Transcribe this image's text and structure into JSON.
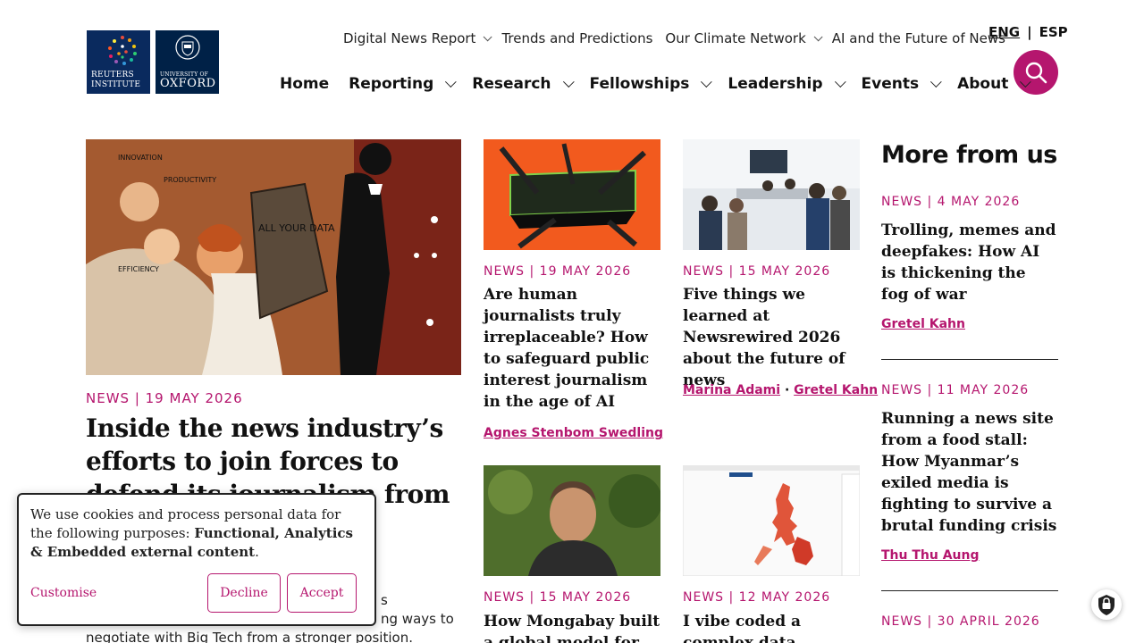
{
  "logos": {
    "reuters": {
      "line1": "REUTERS",
      "line2": "INSTITUTE"
    },
    "oxford": {
      "line1": "UNIVERSITY OF",
      "line2": "OXFORD"
    }
  },
  "topnav": [
    {
      "label": "Digital News Report",
      "dropdown": true
    },
    {
      "label": "Trends and Predictions",
      "dropdown": false
    },
    {
      "label": "Our Climate Network",
      "dropdown": true
    },
    {
      "label": "AI and the Future of News",
      "dropdown": false
    }
  ],
  "lang": {
    "eng": "ENG",
    "sep": "|",
    "esp": "ESP"
  },
  "mainnav": [
    {
      "label": "Home",
      "dropdown": false
    },
    {
      "label": "Reporting",
      "dropdown": true
    },
    {
      "label": "Research",
      "dropdown": true
    },
    {
      "label": "Fellowships",
      "dropdown": true
    },
    {
      "label": "Leadership",
      "dropdown": true
    },
    {
      "label": "Events",
      "dropdown": true
    },
    {
      "label": "About",
      "dropdown": true
    }
  ],
  "hero": {
    "image_text": {
      "innovation": "INNOVATION",
      "productivity": "PRODUCTIVITY",
      "efficiency": "EFFICIENCY",
      "board": "ALL YOUR DATA"
    },
    "meta": "NEWS | 19 MAY 2026",
    "title": "Inside the news industry’s efforts to join forces to defend its journalism from",
    "body_right": "s",
    "body_line2": "ng ways to",
    "body_line3": "negotiate with Big Tech from a stronger position."
  },
  "cards": [
    {
      "meta": "NEWS | 19 MAY 2026",
      "title": "Are human journalists truly irreplaceable? How to safeguard public interest journalism in the age of AI",
      "authors": [
        "Agnes Stenbom Swedling"
      ]
    },
    {
      "meta": "NEWS | 15 MAY 2026",
      "title": "Five things we learned at Newsrewired 2026 about the future of news",
      "authors": [
        "Marina Adami",
        "Gretel Kahn"
      ]
    },
    {
      "meta": "NEWS | 15 MAY 2026",
      "title": "How Mongabay built a global model for"
    },
    {
      "meta": "NEWS | 12 MAY 2026",
      "title": "I vibe coded a complex data visualization and"
    }
  ],
  "sidebar": {
    "heading": "More from us",
    "items": [
      {
        "meta": "NEWS | 4 MAY 2026",
        "title": "Trolling, memes and deepfakes: How AI is thickening the fog of war",
        "author": "Gretel Kahn"
      },
      {
        "meta": "NEWS | 11 MAY 2026",
        "title": "Running a news site from a food stall: How Myanmar’s exiled media is fighting to survive a brutal funding crisis",
        "author": "Thu Thu Aung"
      },
      {
        "meta": "NEWS | 30 APRIL 2026"
      }
    ]
  },
  "cookie": {
    "text_plain": "We use cookies and process personal data for the following purposes: ",
    "text_bold": "Functional, Analytics & Embedded external content",
    "text_end": ".",
    "customise": "Customise",
    "decline": "Decline",
    "accept": "Accept"
  },
  "colors": {
    "accent": "#b5166e",
    "navy": "#0a2a5e"
  }
}
